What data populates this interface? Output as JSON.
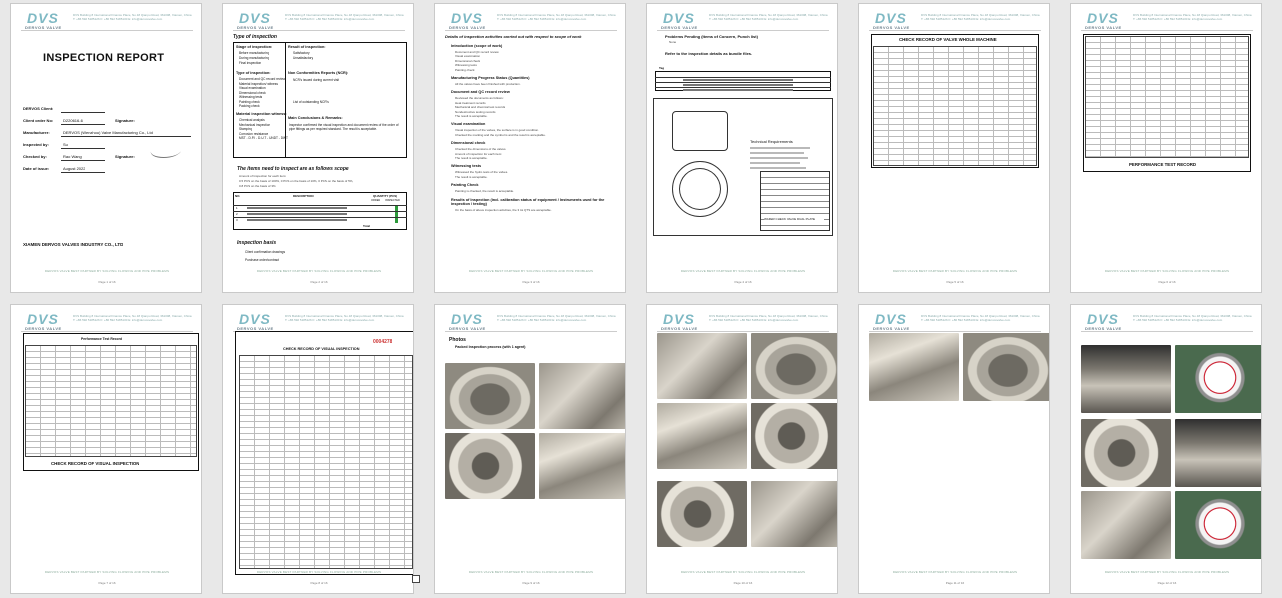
{
  "brand": {
    "logo": "DVS",
    "logo_sub": "DERVOS VALVE",
    "address": "DVS Building 8 International Finance Place, No.18 Qianpu Road, 361008, Xiamen, China",
    "contact": "T: +86 592 5185126   F: +86 592 5185130   E: info@dervosvalve.com",
    "footer": "DERVOS VALVE BEST PARTNER BY SOLVING FLOWING AND PIPE PROBLEMS"
  },
  "page_numbers": [
    "Page 1 of 16",
    "Page 2 of 16",
    "Page 3 of 16",
    "Page 4 of 16",
    "Page 5 of 16",
    "Page 6 of 16",
    "Page 7 of 16",
    "Page 8 of 16",
    "Page 9 of 16",
    "Page 10 of 16",
    "Page 11 of 16",
    "Page 12 of 16"
  ],
  "p1": {
    "title": "INSPECTION REPORT",
    "fields": [
      {
        "label": "DERVOS Client:",
        "value": ""
      },
      {
        "label": "Client order No:",
        "value": "D220616-6"
      },
      {
        "label": "Manufacturer:",
        "value": "DERVOS (Wenzhou) Valve Manufacturing Co., Ltd"
      },
      {
        "label": "Inspected by:",
        "value": "Su"
      },
      {
        "label": "Checked by:",
        "value": "Rao Wang"
      },
      {
        "label": "Date of issue:",
        "value": "August   2022"
      }
    ],
    "signature_label": "Signature:",
    "company": "XIAMEN DERVOS VALVES INDUSTRY CO., LTD"
  },
  "p2": {
    "section": "Type of inspection",
    "stage_title": "Stage of inspection:",
    "stages": [
      "Before manufacturing",
      "During manufacturing",
      "Final inspection"
    ],
    "result_title": "Result of inspection:",
    "results": [
      "Satisfactory",
      "Unsatisfactory"
    ],
    "type_title": "Type of inspection:",
    "types": [
      "Document and QC record review",
      "Material inspection/ witness",
      "Visual examination",
      "Dimensional check",
      "Witnessing tests",
      "Painting check",
      "Packing check"
    ],
    "ncr_title": "Non Conformities Reports (NCR):",
    "ncr_items": [
      "NCR's issued during current visit",
      "List of outstanding NCR's"
    ],
    "material_title": "Material inspection witness:",
    "materials": [
      "Chemical analysis",
      "Mechanical inspection",
      "Stamping",
      "Corrosion resistance",
      "MST - D.P.I - D.U.T - UNDT - DWT"
    ],
    "conclusion_title": "Main Conclusions & Remarks:",
    "conclusion_text": "Inspector confirmed the visual inspection and document review of the order of pipe fittings as per required standard. The result is acceptable.",
    "scope_title": "The items need to inspect are as follows scope",
    "scope_lines": [
      "Amount of Inspection for each item:",
      "0.5 PCS on the basis of 100%,   0 PCS on the basis of 10%,   0 PCS on the basis of 5%,",
      "0.8 PCS on the basis of 3%"
    ],
    "table_head": [
      "NO.",
      "DESCRIPTION",
      "QUANTITY (PCS)"
    ],
    "table_sub": [
      "ORDER",
      "INSPECTED"
    ],
    "rows": [
      [
        "1",
        "",
        ""
      ],
      [
        "2",
        "",
        ""
      ],
      [
        "3",
        "",
        ""
      ]
    ],
    "total": "Total",
    "basis_title": "Inspection basis",
    "basis": [
      "Client confirmation drawings",
      "Purchase order/contract"
    ]
  },
  "p3": {
    "heading": "Details of inspection activities carried out with respect to scope of work",
    "sections": [
      {
        "title": "Introduction (scope of work)",
        "lines": [
          "Document and QC record review",
          "Visual examination",
          "Dimensional check",
          "Witnessing tests",
          "Painting check"
        ]
      },
      {
        "title": "Manufacturing Progress Status (Quantities)",
        "lines": [
          "All the valves have been finished with production."
        ]
      },
      {
        "title": "Document and QC record review",
        "lines": [
          "Reviewed the documents as follows:",
          "Heat treatment records",
          "Mechanical and chemical test records",
          "Nondestructive testing records",
          "The result is acceptable."
        ]
      },
      {
        "title": "Visual examination",
        "lines": [
          "Visual inspection of the valves, the surface is in good condition.",
          "Checked the marking and the symbol is and the result is acceptable."
        ]
      },
      {
        "title": "Dimensional check",
        "lines": [
          "Checked the dimensions of the valves.",
          "Amount of inspection for each item:",
          "The result is acceptable."
        ]
      },
      {
        "title": "Witnessing tests",
        "lines": [
          "Witnessed the hydro tests of the valves.",
          "The result is acceptable."
        ]
      },
      {
        "title": "Painting Check",
        "lines": [
          "Painting is checked, the result is acceptable."
        ]
      },
      {
        "title": "Results of Inspection (incl. calibration status of equipment / Instruments used for the inspection / testing)",
        "lines": [
          "On the basis of above inspection activities, the 3 lot QTS are acceptable."
        ]
      }
    ]
  },
  "p4": {
    "items": [
      {
        "title": "Problems Pending (Items of Concern, Punch list)",
        "lines": [
          "None"
        ]
      },
      {
        "title": "Refer to the inspection details as bundle files.",
        "lines": []
      }
    ],
    "table_title": "Tag",
    "drawing_notes_title": "Technical Requirements",
    "drawing_label": "WAFER CHECK VALVE DUAL PLATE"
  },
  "p5": {
    "caption": "CHECK RECORD OF VALVE WHOLE MACHINE"
  },
  "p6": {
    "caption": "PERFORMANCE TEST RECORD"
  },
  "p7": {
    "caption": "CHECK RECORD OF VISUAL INSPECTION",
    "sheet_title": "Performance Test Record"
  },
  "p8": {
    "sheet_title": "CHECK RECORD OF VISUAL INSPECTION",
    "serial": "0004278"
  },
  "p9": {
    "heading": "Photos",
    "subheading": "Packed Inspection process (with 1 agent)"
  }
}
